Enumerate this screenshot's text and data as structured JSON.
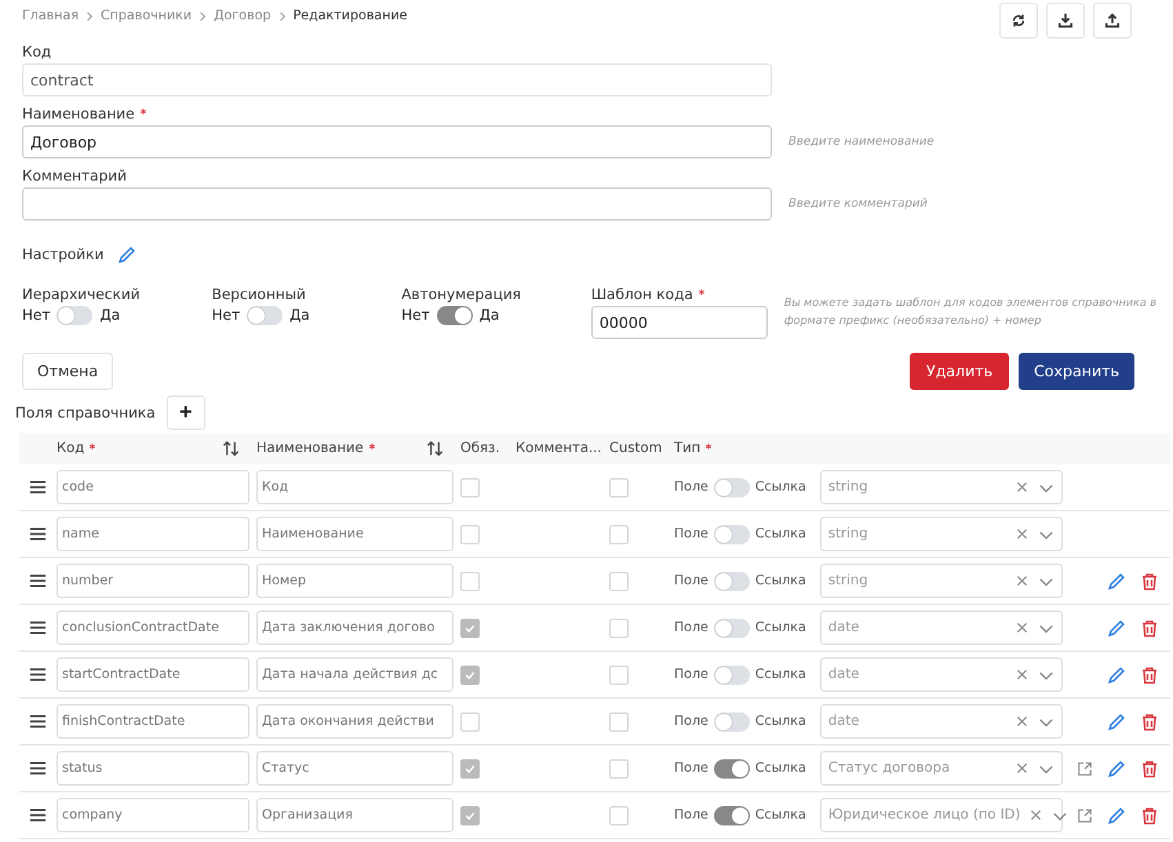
{
  "breadcrumbs": [
    {
      "label": "Главная",
      "current": false
    },
    {
      "label": "Справочники",
      "current": false
    },
    {
      "label": "Договор",
      "current": false
    },
    {
      "label": "Редактирование",
      "current": true
    }
  ],
  "toolbar": [
    {
      "kind": "refresh"
    },
    {
      "kind": "download"
    },
    {
      "kind": "upload"
    }
  ],
  "fields": [
    {
      "label": "Код",
      "required": false,
      "value": "contract"
    },
    {
      "label": "Наименование",
      "required": true,
      "value": "Договор",
      "hint": "Введите наименование"
    },
    {
      "label": "Комментарий",
      "required": false,
      "hint": "Введите комментарий"
    }
  ],
  "settings": {
    "title": "Настройки"
  },
  "switches": [
    {
      "label": "Иерархический",
      "off_label": "Нет",
      "on_label": "Да",
      "on": false
    },
    {
      "label": "Версионный",
      "off_label": "Нет",
      "on_label": "Да",
      "on": false
    },
    {
      "label": "Автонумерация",
      "off_label": "Нет",
      "on_label": "Да",
      "on": true
    }
  ],
  "code_template": {
    "label": "Шаблон кода",
    "required": true,
    "value": "00000",
    "hint": "Вы можете задать шаблон для кодов элементов справочника в формате префикс (необязательно) + номер"
  },
  "buttons": [
    {
      "kind": "cancel",
      "label": "Отмена"
    },
    {
      "kind": "delete",
      "label": "Удалить"
    },
    {
      "kind": "save",
      "label": "Сохранить"
    }
  ],
  "fields_section": {
    "title": "Поля справочника",
    "add": "+"
  },
  "table": {
    "columns": [
      {
        "label": "Код",
        "required": true,
        "sortable": true
      },
      {
        "label": "Наименование",
        "required": true,
        "sortable": true
      },
      {
        "label": "Обяз.",
        "required": false,
        "sortable": false
      },
      {
        "label": "Коммента...",
        "required": false,
        "sortable": false
      },
      {
        "label": "Custom",
        "required": false,
        "sortable": false
      },
      {
        "label": "Тип",
        "required": true,
        "sortable": false
      }
    ],
    "rows": [
      {
        "code": "code",
        "name": "Код",
        "required": false,
        "custom": false,
        "off_label": "Поле",
        "on_label": "Ссылка",
        "link": false,
        "type": "string",
        "openable": false,
        "editable": false,
        "deletable": false
      },
      {
        "code": "name",
        "name": "Наименование",
        "required": false,
        "custom": false,
        "off_label": "Поле",
        "on_label": "Ссылка",
        "link": false,
        "type": "string",
        "openable": false,
        "editable": false,
        "deletable": false
      },
      {
        "code": "number",
        "name": "Номер",
        "required": false,
        "custom": false,
        "off_label": "Поле",
        "on_label": "Ссылка",
        "link": false,
        "type": "string",
        "openable": false,
        "editable": true,
        "deletable": true
      },
      {
        "code": "conclusionContractDate",
        "name": "Дата заключения догово",
        "required": true,
        "custom": false,
        "off_label": "Поле",
        "on_label": "Ссылка",
        "link": false,
        "type": "date",
        "openable": false,
        "editable": true,
        "deletable": true
      },
      {
        "code": "startContractDate",
        "name": "Дата начала действия дс",
        "required": true,
        "custom": false,
        "off_label": "Поле",
        "on_label": "Ссылка",
        "link": false,
        "type": "date",
        "openable": false,
        "editable": true,
        "deletable": true
      },
      {
        "code": "finishContractDate",
        "name": "Дата окончания действи",
        "required": false,
        "custom": false,
        "off_label": "Поле",
        "on_label": "Ссылка",
        "link": false,
        "type": "date",
        "openable": false,
        "editable": true,
        "deletable": true
      },
      {
        "code": "status",
        "name": "Статус",
        "required": true,
        "custom": false,
        "off_label": "Поле",
        "on_label": "Ссылка",
        "link": true,
        "type": "Статус договора",
        "openable": true,
        "editable": true,
        "deletable": true
      },
      {
        "code": "company",
        "name": "Организация",
        "required": true,
        "custom": false,
        "off_label": "Поле",
        "on_label": "Ссылка",
        "link": true,
        "type": "Юридическое лицо (по ID)",
        "openable": true,
        "editable": true,
        "deletable": true
      }
    ]
  }
}
